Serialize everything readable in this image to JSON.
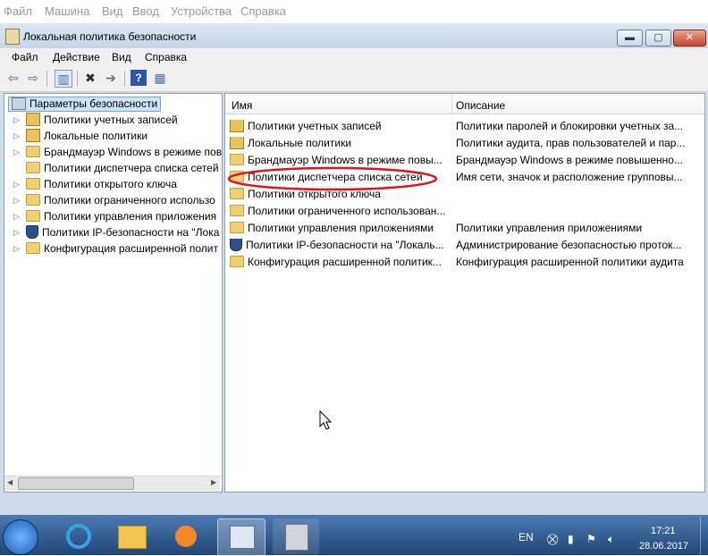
{
  "vm_menu": [
    "Файл",
    "Машина",
    "Вид",
    "Ввод",
    "Устройства",
    "Справка"
  ],
  "window": {
    "title": "Локальная политика безопасности"
  },
  "menubar": [
    "Файл",
    "Действие",
    "Вид",
    "Справка"
  ],
  "tree": {
    "root": "Параметры безопасности",
    "items": [
      {
        "label": "Политики учетных записей",
        "icon": "folder-lock-icon",
        "expandable": true
      },
      {
        "label": "Локальные политики",
        "icon": "folder-lock-icon",
        "expandable": true
      },
      {
        "label": "Брандмауэр Windows в режиме пов",
        "icon": "folder-icon",
        "expandable": true
      },
      {
        "label": "Политики диспетчера списка сетей",
        "icon": "folder-icon",
        "expandable": false
      },
      {
        "label": "Политики открытого ключа",
        "icon": "folder-icon",
        "expandable": true
      },
      {
        "label": "Политики ограниченного использо",
        "icon": "folder-icon",
        "expandable": true
      },
      {
        "label": "Политики управления приложения",
        "icon": "folder-icon",
        "expandable": true
      },
      {
        "label": "Политики IP-безопасности на \"Лока",
        "icon": "ipsec-icon",
        "expandable": true
      },
      {
        "label": "Конфигурация расширенной полит",
        "icon": "folder-icon",
        "expandable": true
      }
    ]
  },
  "list": {
    "headers": {
      "name": "Имя",
      "description": "Описание"
    },
    "rows": [
      {
        "name": "Политики учетных записей",
        "description": "Политики паролей и блокировки учетных за...",
        "icon": "folder-lock-icon"
      },
      {
        "name": "Локальные политики",
        "description": "Политики аудита, прав пользователей и пар...",
        "icon": "folder-lock-icon"
      },
      {
        "name": "Брандмауэр Windows в режиме повы...",
        "description": "Брандмауэр Windows в режиме повышенно...",
        "icon": "folder-icon"
      },
      {
        "name": "Политики диспетчера списка сетей",
        "description": "Имя сети, значок и расположение групповы...",
        "icon": "folder-icon"
      },
      {
        "name": "Политики открытого ключа",
        "description": "",
        "icon": "folder-icon"
      },
      {
        "name": "Политики ограниченного использован...",
        "description": "",
        "icon": "folder-icon"
      },
      {
        "name": "Политики управления приложениями",
        "description": "Политики управления приложениями",
        "icon": "folder-icon"
      },
      {
        "name": "Политики IP-безопасности на \"Локаль...",
        "description": "Администрирование безопасностью проток...",
        "icon": "ipsec-icon"
      },
      {
        "name": "Конфигурация расширенной политик...",
        "description": "Конфигурация расширенной политики аудита",
        "icon": "folder-icon"
      }
    ],
    "highlight_color": "#e0121c"
  },
  "tray": {
    "lang": "EN",
    "time": "17:21",
    "date": "28.06.2017"
  }
}
